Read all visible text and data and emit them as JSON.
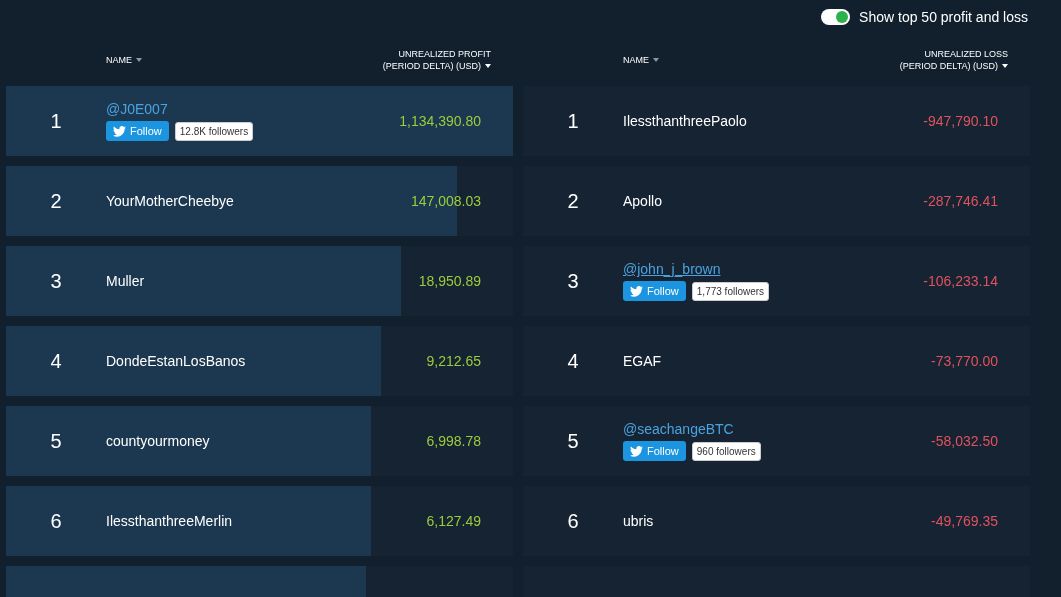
{
  "toggle": {
    "label": "Show top 50 profit and loss",
    "on": true
  },
  "panels": [
    {
      "kind": "profit",
      "header": {
        "name": "NAME",
        "value_lines": [
          "UNREALIZED PROFIT",
          "(PERIOD DELTA) (USD)"
        ]
      },
      "rows": [
        {
          "rank": "1",
          "name": "@J0E007",
          "twitter": {
            "button": "Follow",
            "followers": "12.8K followers"
          },
          "value": "1,134,390.80",
          "level": 1
        },
        {
          "rank": "2",
          "name": "YourMotherCheebye",
          "value": "147,008.03",
          "level": 0.89
        },
        {
          "rank": "3",
          "name": "Muller",
          "value": "18,950.89",
          "level": 0.78
        },
        {
          "rank": "4",
          "name": "DondeEstanLosBanos",
          "value": "9,212.65",
          "level": 0.74
        },
        {
          "rank": "5",
          "name": "countyourmoney",
          "value": "6,998.78",
          "level": 0.72
        },
        {
          "rank": "6",
          "name": "IlessthanthreeMerlin",
          "value": "6,127.49",
          "level": 0.72
        },
        {
          "partial": true,
          "level": 0.71
        }
      ]
    },
    {
      "kind": "loss",
      "header": {
        "name": "NAME",
        "value_lines": [
          "UNREALIZED LOSS",
          "(PERIOD DELTA) (USD)"
        ]
      },
      "rows": [
        {
          "rank": "1",
          "name": "IlessthanthreePaolo",
          "value": "-947,790.10"
        },
        {
          "rank": "2",
          "name": "Apollo",
          "value": "-287,746.41"
        },
        {
          "rank": "3",
          "name": "@john_j_brown",
          "twitter": {
            "button": "Follow",
            "followers": "1,773 followers"
          },
          "value": "-106,233.14"
        },
        {
          "rank": "4",
          "name": "EGAF",
          "value": "-73,770.00"
        },
        {
          "rank": "5",
          "name": "@seachangeBTC",
          "twitter": {
            "button": "Follow",
            "followers": "960 followers"
          },
          "value": "-58,032.50"
        },
        {
          "rank": "6",
          "name": "ubris",
          "value": "-49,769.35"
        },
        {
          "partial": true
        }
      ]
    }
  ]
}
